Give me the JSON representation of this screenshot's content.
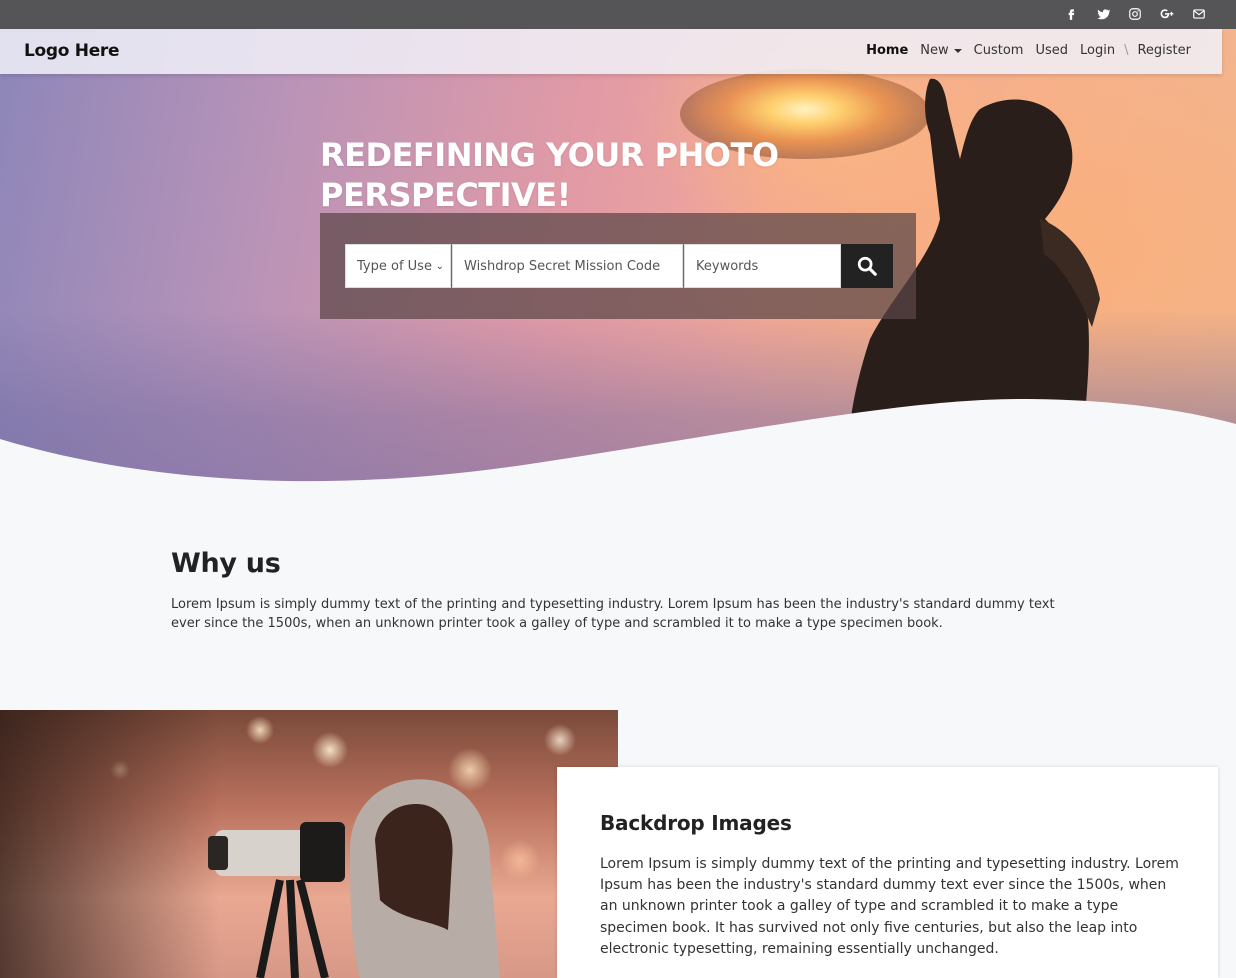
{
  "topbar": {
    "icons": [
      "facebook-icon",
      "twitter-icon",
      "instagram-icon",
      "google-plus-icon",
      "envelope-icon"
    ]
  },
  "navbar": {
    "logo": "Logo Here",
    "items": [
      {
        "label": "Home",
        "active": true
      },
      {
        "label": "New"
      },
      {
        "label": "Custom"
      },
      {
        "label": "Used"
      },
      {
        "label": "Login"
      },
      {
        "label": "Register"
      }
    ],
    "separator": "\\"
  },
  "hero": {
    "headline": "REDEFINING YOUR PHOTO PERSPECTIVE!",
    "search": {
      "type_select_value": "Type of Use",
      "mission_placeholder": "Wishdrop Secret Mission Code",
      "keywords_placeholder": "Keywords",
      "button_icon": "search-icon"
    }
  },
  "why_us": {
    "title": "Why us",
    "text": "Lorem Ipsum is simply dummy text of the printing and typesetting industry. Lorem Ipsum has been the industry's standard dummy text ever since the 1500s, when an unknown printer took a galley of type and scrambled it to make a type specimen book."
  },
  "backdrop": {
    "title": "Backdrop Images",
    "text": "Lorem Ipsum is simply dummy text of the printing and typesetting industry. Lorem Ipsum has been the industry's standard dummy text ever since the 1500s, when an unknown printer took a galley of type and scrambled it to make a type specimen book. It has survived not only five centuries, but also the leap into electronic typesetting, remaining essentially unchanged."
  },
  "colors": {
    "topbar": "#555557",
    "search_button": "#222222",
    "page_background": "#f7f8fa"
  }
}
